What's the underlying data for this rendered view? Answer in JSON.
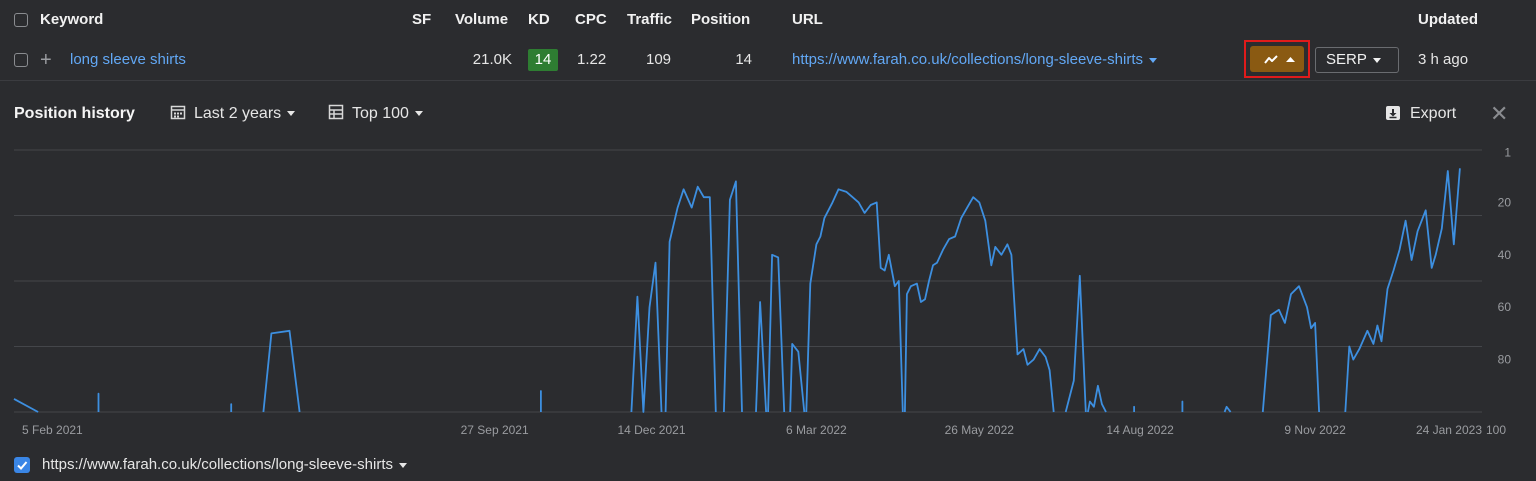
{
  "table": {
    "headers": {
      "keyword": "Keyword",
      "sf": "SF",
      "volume": "Volume",
      "kd": "KD",
      "cpc": "CPC",
      "traffic": "Traffic",
      "position": "Position",
      "url": "URL",
      "updated": "Updated"
    },
    "row": {
      "keyword": "long sleeve shirts",
      "volume": "21.0K",
      "kd": "14",
      "cpc": "1.22",
      "traffic": "109",
      "position": "14",
      "url": "https://www.farah.co.uk/collections/long-sleeve-shirts",
      "serp_label": "SERP",
      "updated": "3 h ago"
    }
  },
  "panel": {
    "title": "Position history",
    "range_label": "Last 2 years",
    "top_label": "Top 100",
    "export_label": "Export"
  },
  "legend": {
    "url": "https://www.farah.co.uk/collections/long-sleeve-shirts"
  },
  "colors": {
    "line": "#3d8fe0",
    "kd_badge": "#2e7d32",
    "highlight_border": "#e01b1b",
    "chart_button": "#8a5a12",
    "link": "#62a8f5"
  },
  "chart_data": {
    "type": "line",
    "x_tick_labels": [
      "5 Feb 2021",
      "27 Sep 2021",
      "14 Dec 2021",
      "6 Mar 2022",
      "26 May 2022",
      "14 Aug 2022",
      "9 Nov 2022",
      "24 Jan 2023"
    ],
    "x_ticks": [
      "2021-02-05",
      "2021-09-27",
      "2021-12-14",
      "2022-03-06",
      "2022-05-26",
      "2022-08-14",
      "2022-11-09",
      "2023-01-24"
    ],
    "x_range": [
      "2021-01-31",
      "2023-01-31"
    ],
    "y_tick_labels": [
      "1",
      "20",
      "40",
      "60",
      "80",
      "100"
    ],
    "y_ticks": [
      1,
      20,
      40,
      60,
      80,
      100
    ],
    "ylim": [
      100,
      0
    ],
    "y_inverted": true,
    "grid": true,
    "series": [
      {
        "segments": [
          [
            [
              "2021-01-31",
              95
            ],
            [
              "2021-02-12",
              100
            ]
          ],
          [
            [
              "2021-03-14",
              100
            ],
            [
              "2021-03-14",
              93
            ],
            [
              "2021-03-14",
              100
            ]
          ],
          [
            [
              "2021-05-19",
              100
            ],
            [
              "2021-05-19",
              97
            ],
            [
              "2021-05-19",
              100
            ]
          ],
          [
            [
              "2021-06-04",
              100
            ],
            [
              "2021-06-08",
              70
            ],
            [
              "2021-06-17",
              69
            ],
            [
              "2021-06-22",
              100
            ]
          ],
          [
            [
              "2021-10-20",
              100
            ],
            [
              "2021-10-20",
              92
            ],
            [
              "2021-10-20",
              100
            ]
          ],
          [
            [
              "2021-12-04",
              100
            ],
            [
              "2021-12-07",
              56
            ],
            [
              "2021-12-10",
              100
            ],
            [
              "2021-12-13",
              60
            ],
            [
              "2021-12-16",
              43
            ],
            [
              "2021-12-19",
              100
            ]
          ],
          [
            [
              "2021-12-21",
              100
            ],
            [
              "2021-12-23",
              35
            ],
            [
              "2021-12-27",
              22
            ],
            [
              "2021-12-30",
              15
            ],
            [
              "2022-01-03",
              22
            ],
            [
              "2022-01-06",
              14
            ],
            [
              "2022-01-09",
              18
            ],
            [
              "2022-01-12",
              18
            ],
            [
              "2022-01-15",
              100
            ]
          ],
          [
            [
              "2022-01-19",
              100
            ],
            [
              "2022-01-22",
              19
            ],
            [
              "2022-01-25",
              12
            ],
            [
              "2022-01-28",
              100
            ]
          ],
          [
            [
              "2022-02-04",
              100
            ],
            [
              "2022-02-06",
              58
            ],
            [
              "2022-02-09",
              100
            ]
          ],
          [
            [
              "2022-02-10",
              100
            ],
            [
              "2022-02-12",
              40
            ],
            [
              "2022-02-15",
              41
            ],
            [
              "2022-02-18",
              100
            ]
          ],
          [
            [
              "2022-02-21",
              100
            ],
            [
              "2022-02-22",
              74
            ],
            [
              "2022-02-25",
              77
            ],
            [
              "2022-02-28",
              100
            ]
          ],
          [
            [
              "2022-03-01",
              100
            ],
            [
              "2022-03-03",
              51
            ],
            [
              "2022-03-06",
              36
            ],
            [
              "2022-03-08",
              33
            ],
            [
              "2022-03-10",
              26
            ],
            [
              "2022-03-14",
              20
            ],
            [
              "2022-03-17",
              15
            ],
            [
              "2022-03-21",
              16
            ],
            [
              "2022-03-24",
              18
            ],
            [
              "2022-03-27",
              20
            ],
            [
              "2022-03-30",
              24
            ],
            [
              "2022-04-02",
              21
            ],
            [
              "2022-04-05",
              20
            ],
            [
              "2022-04-07",
              45
            ],
            [
              "2022-04-09",
              46
            ],
            [
              "2022-04-11",
              40
            ],
            [
              "2022-04-14",
              52
            ],
            [
              "2022-04-16",
              50
            ],
            [
              "2022-04-18",
              100
            ]
          ],
          [
            [
              "2022-04-19",
              100
            ],
            [
              "2022-04-20",
              55
            ],
            [
              "2022-04-22",
              52
            ],
            [
              "2022-04-25",
              51
            ],
            [
              "2022-04-27",
              58
            ],
            [
              "2022-04-29",
              57
            ],
            [
              "2022-05-01",
              50
            ],
            [
              "2022-05-03",
              44
            ],
            [
              "2022-05-05",
              43
            ],
            [
              "2022-05-08",
              38
            ],
            [
              "2022-05-11",
              34
            ],
            [
              "2022-05-14",
              33
            ],
            [
              "2022-05-17",
              26
            ],
            [
              "2022-05-20",
              22
            ],
            [
              "2022-05-23",
              18
            ],
            [
              "2022-05-26",
              20
            ],
            [
              "2022-05-29",
              27
            ],
            [
              "2022-06-01",
              44
            ],
            [
              "2022-06-03",
              37
            ],
            [
              "2022-06-06",
              40
            ],
            [
              "2022-06-09",
              36
            ],
            [
              "2022-06-11",
              40
            ],
            [
              "2022-06-14",
              78
            ],
            [
              "2022-06-17",
              76
            ],
            [
              "2022-06-19",
              82
            ],
            [
              "2022-06-22",
              80
            ],
            [
              "2022-06-25",
              76
            ],
            [
              "2022-06-28",
              79
            ],
            [
              "2022-06-30",
              84
            ],
            [
              "2022-07-02",
              100
            ]
          ],
          [
            [
              "2022-07-08",
              100
            ],
            [
              "2022-07-12",
              88
            ],
            [
              "2022-07-15",
              48
            ],
            [
              "2022-07-18",
              100
            ]
          ],
          [
            [
              "2022-07-19",
              100
            ],
            [
              "2022-07-20",
              96
            ],
            [
              "2022-07-22",
              98
            ],
            [
              "2022-07-24",
              90
            ],
            [
              "2022-07-26",
              97
            ],
            [
              "2022-07-28",
              100
            ]
          ],
          [
            [
              "2022-08-11",
              100
            ],
            [
              "2022-08-11",
              98
            ],
            [
              "2022-08-11",
              100
            ]
          ],
          [
            [
              "2022-09-04",
              100
            ],
            [
              "2022-09-04",
              96
            ],
            [
              "2022-09-04",
              100
            ]
          ],
          [
            [
              "2022-09-25",
              100
            ],
            [
              "2022-09-26",
              98
            ],
            [
              "2022-09-28",
              100
            ]
          ],
          [
            [
              "2022-10-14",
              100
            ],
            [
              "2022-10-18",
              63
            ],
            [
              "2022-10-22",
              61
            ],
            [
              "2022-10-25",
              66
            ],
            [
              "2022-10-28",
              55
            ],
            [
              "2022-11-01",
              52
            ],
            [
              "2022-11-05",
              60
            ],
            [
              "2022-11-07",
              68
            ],
            [
              "2022-11-09",
              66
            ],
            [
              "2022-11-11",
              100
            ]
          ],
          [
            [
              "2022-11-24",
              100
            ],
            [
              "2022-11-26",
              75
            ],
            [
              "2022-11-28",
              80
            ],
            [
              "2022-12-01",
              76
            ],
            [
              "2022-12-05",
              69
            ],
            [
              "2022-12-08",
              74
            ],
            [
              "2022-12-10",
              67
            ],
            [
              "2022-12-12",
              73
            ],
            [
              "2022-12-15",
              53
            ],
            [
              "2022-12-18",
              46
            ],
            [
              "2022-12-21",
              38
            ],
            [
              "2022-12-24",
              27
            ],
            [
              "2022-12-27",
              42
            ],
            [
              "2022-12-30",
              31
            ],
            [
              "2023-01-03",
              23
            ],
            [
              "2023-01-06",
              45
            ],
            [
              "2023-01-08",
              40
            ],
            [
              "2023-01-11",
              30
            ],
            [
              "2023-01-14",
              8
            ],
            [
              "2023-01-17",
              36
            ],
            [
              "2023-01-20",
              7
            ]
          ]
        ]
      }
    ]
  }
}
